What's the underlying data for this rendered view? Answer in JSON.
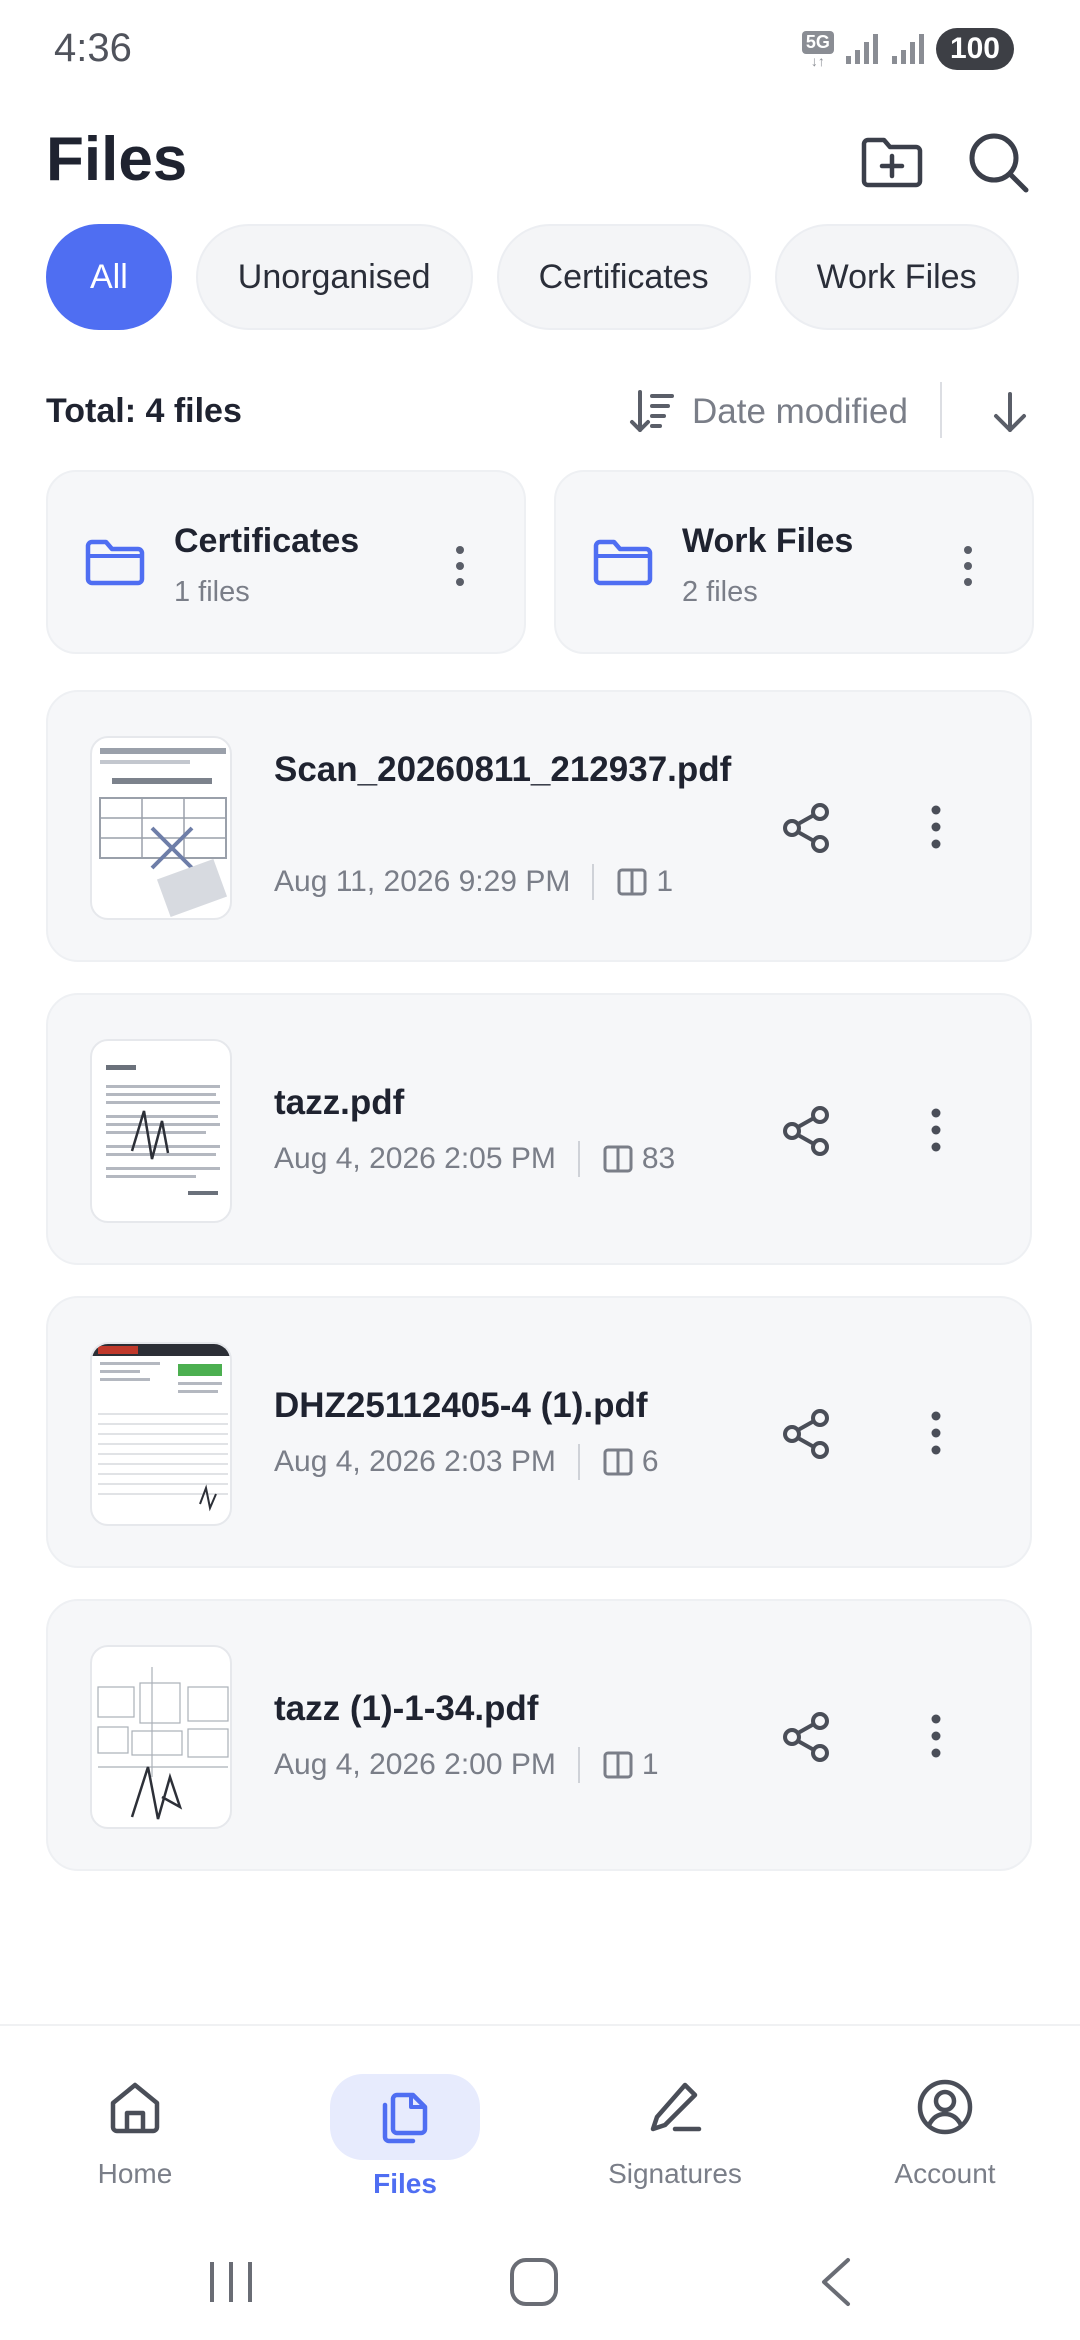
{
  "status_bar": {
    "time": "4:36",
    "network": "5G",
    "battery": "100"
  },
  "header": {
    "title": "Files"
  },
  "filters": [
    {
      "label": "All",
      "active": true
    },
    {
      "label": "Unorganised",
      "active": false
    },
    {
      "label": "Certificates",
      "active": false
    },
    {
      "label": "Work Files",
      "active": false
    }
  ],
  "list_info": {
    "total": "Total: 4 files",
    "sort_label": "Date modified"
  },
  "folders": [
    {
      "name": "Certificates",
      "count": "1 files"
    },
    {
      "name": "Work Files",
      "count": "2 files"
    }
  ],
  "files": [
    {
      "name": "Scan_20260811_212937.pdf",
      "date": "Aug 11, 2026 9:29 PM",
      "pages": "1"
    },
    {
      "name": "tazz.pdf",
      "date": "Aug 4, 2026 2:05 PM",
      "pages": "83"
    },
    {
      "name": "DHZ25112405-4 (1).pdf",
      "date": "Aug 4, 2026 2:03 PM",
      "pages": "6"
    },
    {
      "name": "tazz (1)-1-34.pdf",
      "date": "Aug 4, 2026 2:00 PM",
      "pages": "1"
    }
  ],
  "bottom_nav": [
    {
      "label": "Home",
      "icon": "home-icon",
      "active": false
    },
    {
      "label": "Files",
      "icon": "files-icon",
      "active": true
    },
    {
      "label": "Signatures",
      "icon": "pen-icon",
      "active": false
    },
    {
      "label": "Account",
      "icon": "account-icon",
      "active": false
    }
  ],
  "colors": {
    "accent": "#4f6ef2",
    "card": "#f6f7f9",
    "text": "#1f2330",
    "muted": "#7a7e88"
  }
}
